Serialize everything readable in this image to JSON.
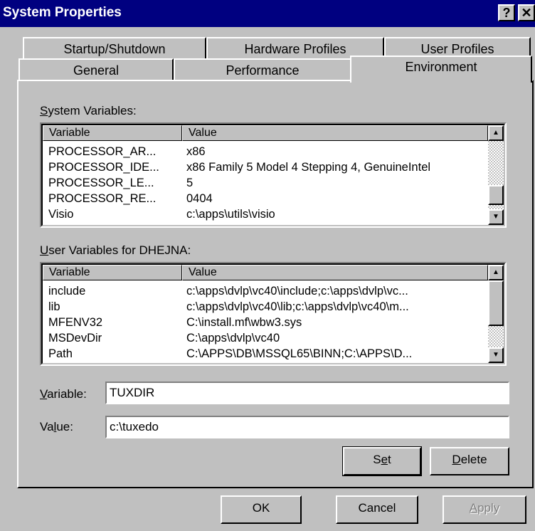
{
  "window": {
    "title": "System Properties",
    "help_label": "?",
    "close_label": "✕"
  },
  "tabs": {
    "row1": [
      "Startup/Shutdown",
      "Hardware Profiles",
      "User Profiles"
    ],
    "row2": [
      "General",
      "Performance",
      "Environment"
    ]
  },
  "system_vars": {
    "label_mnemonic": "S",
    "label_rest": "ystem Variables:",
    "col_variable": "Variable",
    "col_value": "Value",
    "rows": [
      {
        "var": "PROCESSOR_AR...",
        "val": "x86"
      },
      {
        "var": "PROCESSOR_IDE...",
        "val": "x86 Family 5 Model 4 Stepping 4, GenuineIntel"
      },
      {
        "var": "PROCESSOR_LE...",
        "val": "5"
      },
      {
        "var": "PROCESSOR_RE...",
        "val": "0404"
      },
      {
        "var": "Visio",
        "val": "c:\\apps\\utils\\visio"
      }
    ]
  },
  "user_vars": {
    "label_mnemonic": "U",
    "label_rest": "ser Variables for DHEJNA:",
    "col_variable": "Variable",
    "col_value": "Value",
    "rows": [
      {
        "var": "include",
        "val": "c:\\apps\\dvlp\\vc40\\include;c:\\apps\\dvlp\\vc..."
      },
      {
        "var": "lib",
        "val": "c:\\apps\\dvlp\\vc40\\lib;c:\\apps\\dvlp\\vc40\\m..."
      },
      {
        "var": "MFENV32",
        "val": "C:\\install.mf\\wbw3.sys"
      },
      {
        "var": "MSDevDir",
        "val": "C:\\apps\\dvlp\\vc40"
      },
      {
        "var": "Path",
        "val": "C:\\APPS\\DB\\MSSQL65\\BINN;C:\\APPS\\D..."
      }
    ]
  },
  "fields": {
    "variable_label_mnemonic": "V",
    "variable_label_rest": "ariable:",
    "variable_value": "TUXDIR",
    "value_label_pre": "Va",
    "value_label_mnemonic": "l",
    "value_label_rest": "ue:",
    "value_value": "c:\\tuxedo"
  },
  "buttons": {
    "set_pre": "S",
    "set_mnemonic": "e",
    "set_rest": "t",
    "delete_mnemonic": "D",
    "delete_rest": "elete",
    "ok": "OK",
    "cancel": "Cancel",
    "apply_mnemonic": "A",
    "apply_rest": "pply"
  },
  "icons": {
    "scroll_up": "scroll-up-arrow-icon",
    "scroll_down": "scroll-down-arrow-icon"
  },
  "colors": {
    "titlebar": "#000080",
    "face": "#c0c0c0"
  }
}
